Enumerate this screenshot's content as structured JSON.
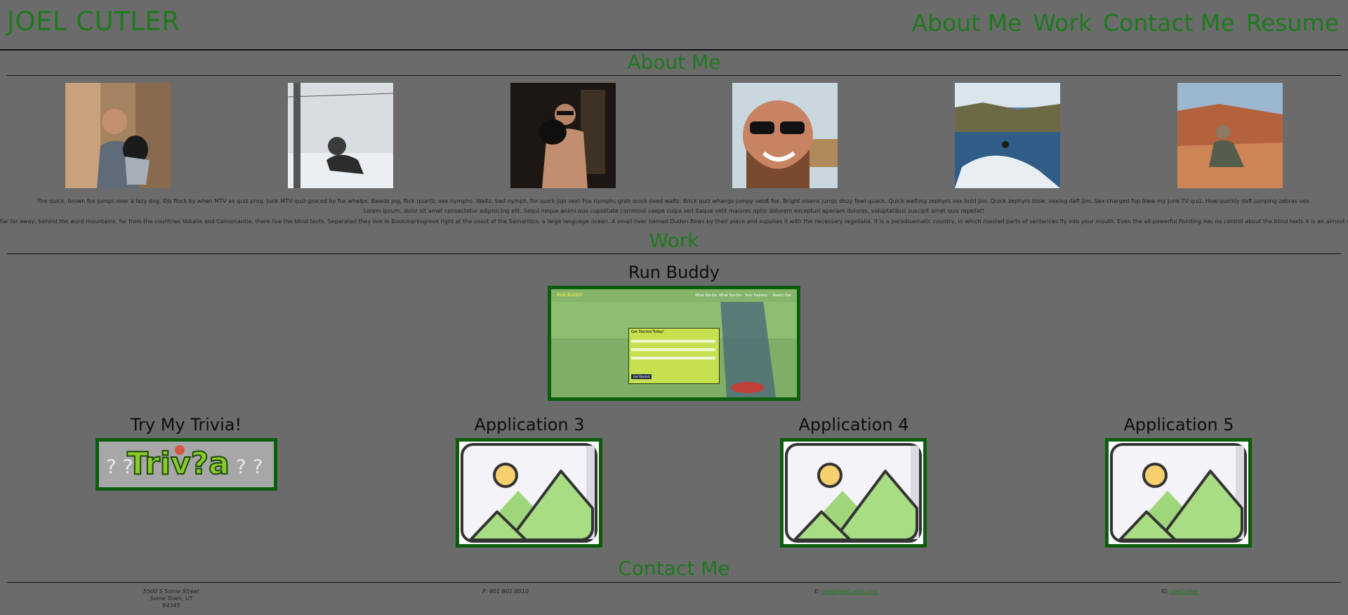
{
  "header": {
    "title": "JOEL CUTLER",
    "nav": [
      "About Me",
      "Work",
      "Contact Me",
      "Resume"
    ]
  },
  "about": {
    "title": "About Me",
    "paragraphs": [
      "The quick, brown fox jumps over a lazy dog. DJs flock by when MTV ax quiz prog. Junk MTV quiz graced by fox whelps. Bawds jog, flick quartz, vex nymphs. Waltz, bad nymph, for quick jigs vex! Fox nymphs grab quick-jived waltz. Brick quiz whangs jumpy veldt fox. Bright vixens jump; dozy fowl quack. Quick wafting zephyrs vex bold Jim. Quick zephyrs blow, vexing daft Jim. Sex-charged fop blew my junk TV quiz. How quickly daft jumping zebras vex.",
      "Lorem ipsum, dolor sit amet consectetur adipisicing elit. Sequi neque animi quo cupiditate commodi saepe culpa sed itaque velit maiores optio dolorem excepturi aperiam dolores, voluptatibus suscipit amet quis repellat!",
      "Far far away, behind the word mountains, far from the countries Vokalia and Consonantia, there live the blind texts. Separated they live in Bookmarksgrove right at the coast of the Semantics, a large language ocean. A small river named Duden flows by their place and supplies it with the necessary regelialia. It is a paradisematic country, in which roasted parts of sentences fly into your mouth. Even the all-powerful Pointing has no control about the blind texts it is an almost unorthographic life One day however a small line."
    ]
  },
  "work": {
    "title": "Work",
    "featured": {
      "title": "Run Buddy",
      "screenshot": {
        "brand": "RUN BUDDY",
        "nav": [
          "What We Do",
          "What You Do",
          "Your Trainers",
          "Reach Out"
        ],
        "form_title": "Get Started Today!",
        "submit": "Get Started"
      }
    },
    "projects": [
      {
        "title": "Try My Trivia!",
        "banner": "Triv?a"
      },
      {
        "title": "Application 3"
      },
      {
        "title": "Application 4"
      },
      {
        "title": "Application 5"
      }
    ]
  },
  "contact": {
    "title": "Contact Me",
    "address": [
      "5500 S Some Street",
      "Some Town, UT",
      "84345"
    ],
    "phone": "P: 801.801.8010",
    "email_prefix": "E: ",
    "email": "Joel@JoelCutler.com",
    "ig_prefix": "IG: ",
    "ig": "JoelCutler"
  },
  "colors": {
    "background": "#6b6b6b",
    "accent": "#1d7a1d",
    "frame": "#0c5e0c"
  }
}
